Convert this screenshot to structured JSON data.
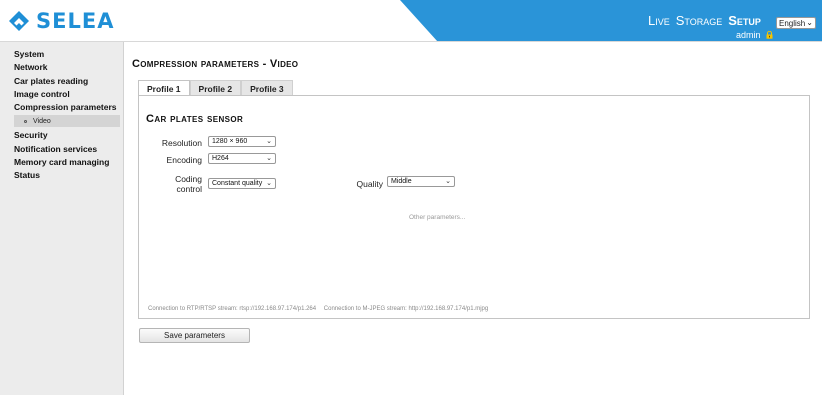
{
  "brand": {
    "name": "SELEA",
    "color": "#1f8fd6",
    "logo_icon": "diamond-chevron-logo"
  },
  "header": {
    "accent_color": "#2a94d8",
    "nav": [
      {
        "label": "Live"
      },
      {
        "label": "Storage"
      },
      {
        "label": "Setup",
        "active": true
      }
    ],
    "language": "English",
    "user": "admin",
    "user_icon": "lock-icon"
  },
  "sidebar": {
    "items": [
      {
        "label": "System"
      },
      {
        "label": "Network"
      },
      {
        "label": "Car plates reading"
      },
      {
        "label": "Image control"
      },
      {
        "label": "Compression parameters"
      },
      {
        "label": "Security"
      },
      {
        "label": "Notification services"
      },
      {
        "label": "Memory card managing"
      },
      {
        "label": "Status"
      }
    ],
    "sub_item": {
      "label": "Video",
      "parent": "Compression parameters",
      "active": true
    }
  },
  "main": {
    "title": "Compression parameters - Video",
    "tabs": [
      {
        "label": "Profile 1",
        "active": true
      },
      {
        "label": "Profile 2"
      },
      {
        "label": "Profile 3"
      }
    ],
    "section_title": "Car plates sensor",
    "fields": {
      "resolution": {
        "label": "Resolution",
        "value": "1280 × 960"
      },
      "encoding": {
        "label": "Encoding",
        "value": "H264"
      },
      "coding_control": {
        "label_line1": "Coding",
        "label_line2": "control",
        "value": "Constant quality"
      },
      "quality": {
        "label": "Quality",
        "value": "Middle"
      }
    },
    "other_parameters": "Other parameters...",
    "connections": {
      "rtsp": "Connection to RTP/RTSP stream: rtsp://192.168.97.174/p1.264",
      "mjpeg": "Connection to M-JPEG stream: http://192.168.97.174/p1.mjpg"
    },
    "save_label": "Save parameters"
  }
}
